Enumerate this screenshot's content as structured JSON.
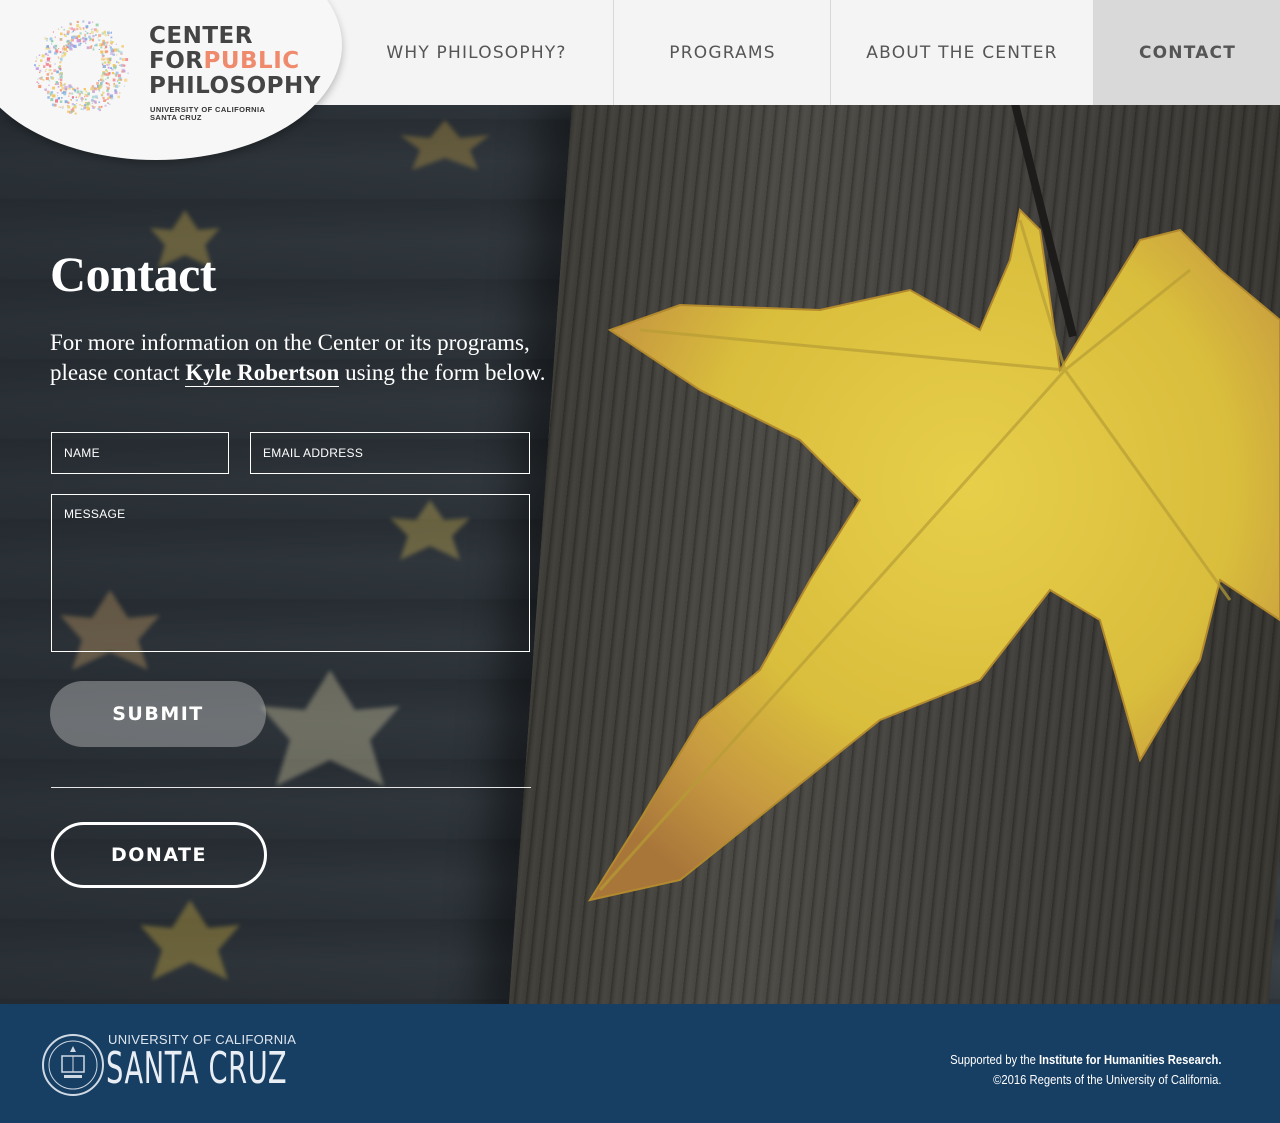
{
  "logo": {
    "line1": "CENTER",
    "line2_a": "FOR",
    "line2_b": "PUBLIC",
    "line3": "PHILOSOPHY",
    "sub1": "UNIVERSITY OF CALIFORNIA",
    "sub2": "SANTA CRUZ"
  },
  "nav": {
    "items": [
      {
        "label": "WHY PHILOSOPHY?"
      },
      {
        "label": "PROGRAMS"
      },
      {
        "label": "ABOUT THE CENTER"
      },
      {
        "label": "CONTACT",
        "active": true
      }
    ]
  },
  "main": {
    "title": "Contact",
    "intro_before": "For more information on the Center or its programs, please contact ",
    "intro_link": "Kyle Robertson",
    "intro_after": " using the form below."
  },
  "form": {
    "name_placeholder": "NAME",
    "email_placeholder": "EMAIL ADDRESS",
    "message_placeholder": "MESSAGE",
    "submit_label": "SUBMIT"
  },
  "donate": {
    "label": "DONATE"
  },
  "footer": {
    "ucsc_top": "UNIVERSITY OF CALIFORNIA",
    "ucsc_main": "SANTA CRUZ",
    "supported_prefix": "Supported by the ",
    "supported_org": "Institute for Humanities Research.",
    "copyright": "©2016 Regents of the University of California."
  },
  "colors": {
    "header_bg": "#f4f4f4",
    "active_tab_bg": "#d9d9d9",
    "logo_accent": "#ef8a6c",
    "footer_bg": "#173e63"
  }
}
